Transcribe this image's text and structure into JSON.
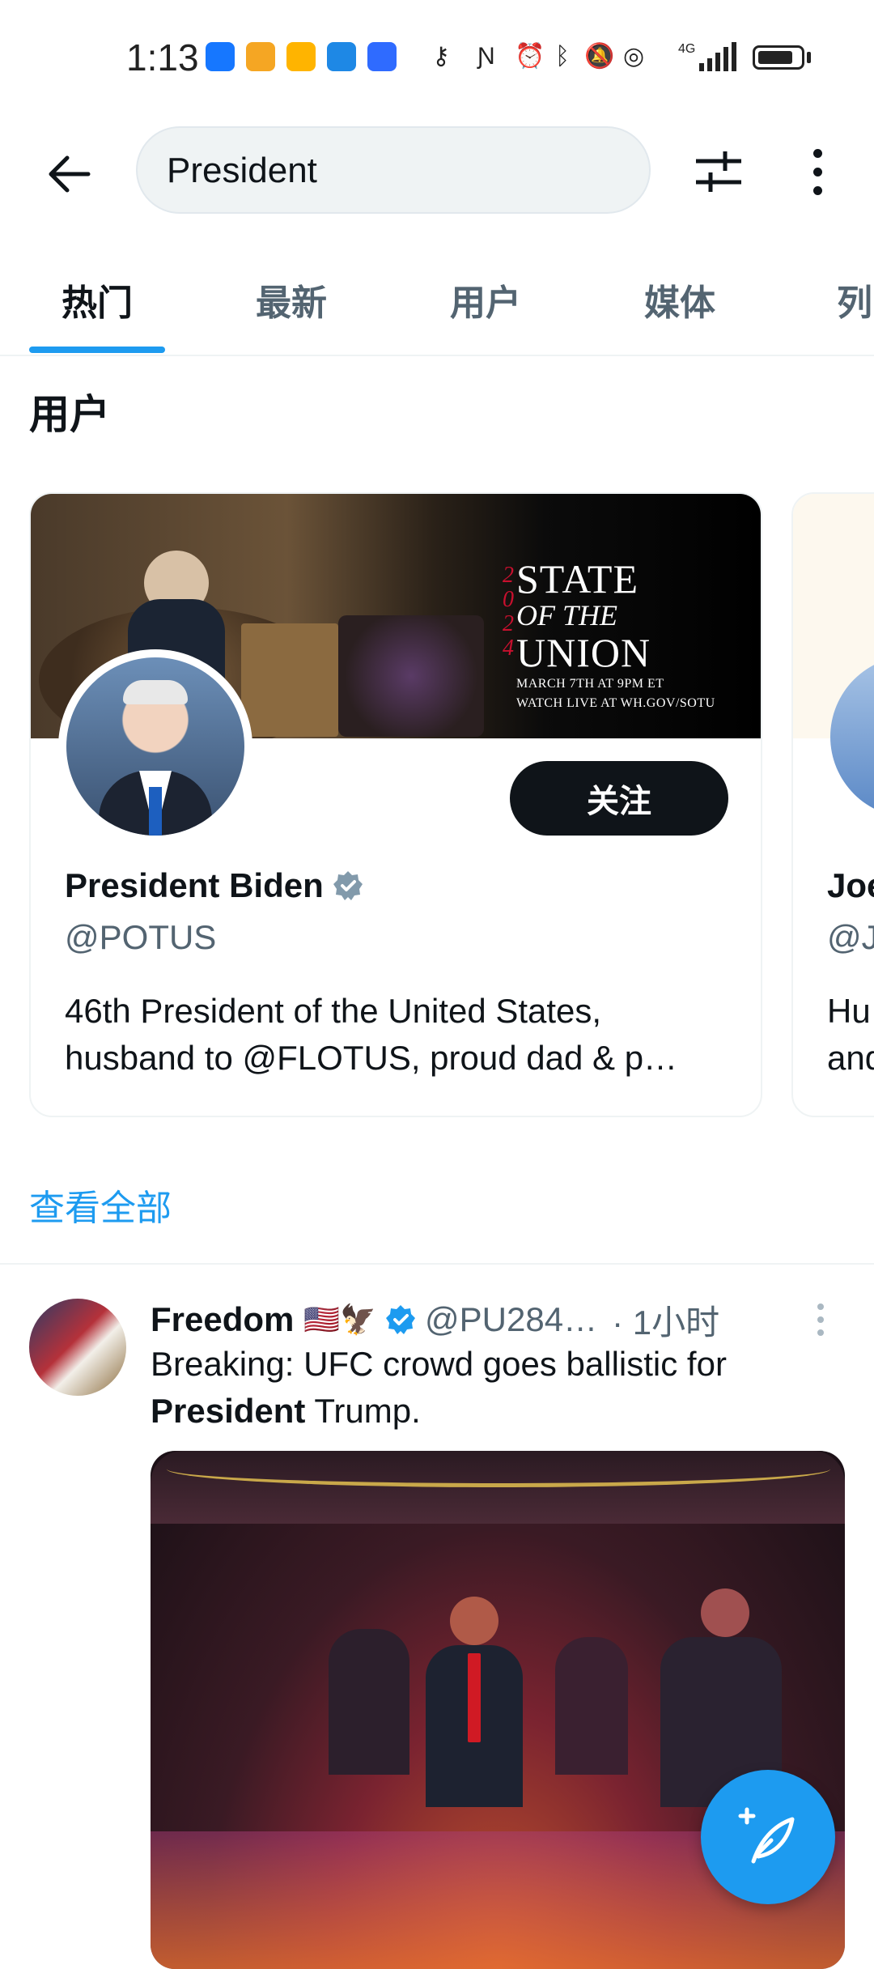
{
  "status_bar": {
    "time": "1:13",
    "network": "4G",
    "battery_level": 0.8
  },
  "header": {
    "search_value": "President",
    "filter_icon": "sliders-icon",
    "more_icon": "more-vertical-icon"
  },
  "tabs": [
    {
      "label": "热门",
      "active": true
    },
    {
      "label": "最新",
      "active": false
    },
    {
      "label": "用户",
      "active": false
    },
    {
      "label": "媒体",
      "active": false
    },
    {
      "label": "列",
      "active": false
    }
  ],
  "users_section": {
    "heading": "用户",
    "view_all": "查看全部",
    "cards": [
      {
        "banner": {
          "year": "2024",
          "line1": "STATE",
          "line2": "OF THE",
          "line3": "UNION",
          "sub1": "MARCH 7TH AT 9PM ET",
          "sub2": "WATCH LIVE AT WH.GOV/SOTU"
        },
        "follow_label": "关注",
        "name": "President Biden",
        "handle": "@POTUS",
        "bio": "46th President of the United States, husband to @FLOTUS, proud dad & p…"
      },
      {
        "name": "Joe",
        "handle": "@J",
        "bio_line1": "Hu",
        "bio_line2": "and"
      }
    ]
  },
  "tweet": {
    "name": "Freedom",
    "flags": "🇺🇸🦅",
    "handle": "@PU284…",
    "time": "· 1小时",
    "body_prefix": "Breaking: UFC crowd  goes ballistic for",
    "body_bold": "President",
    "body_suffix": " Trump."
  },
  "colors": {
    "accent": "#1d9bf0",
    "text": "#0f1419",
    "secondary": "#536471",
    "verified": "#829aab"
  }
}
